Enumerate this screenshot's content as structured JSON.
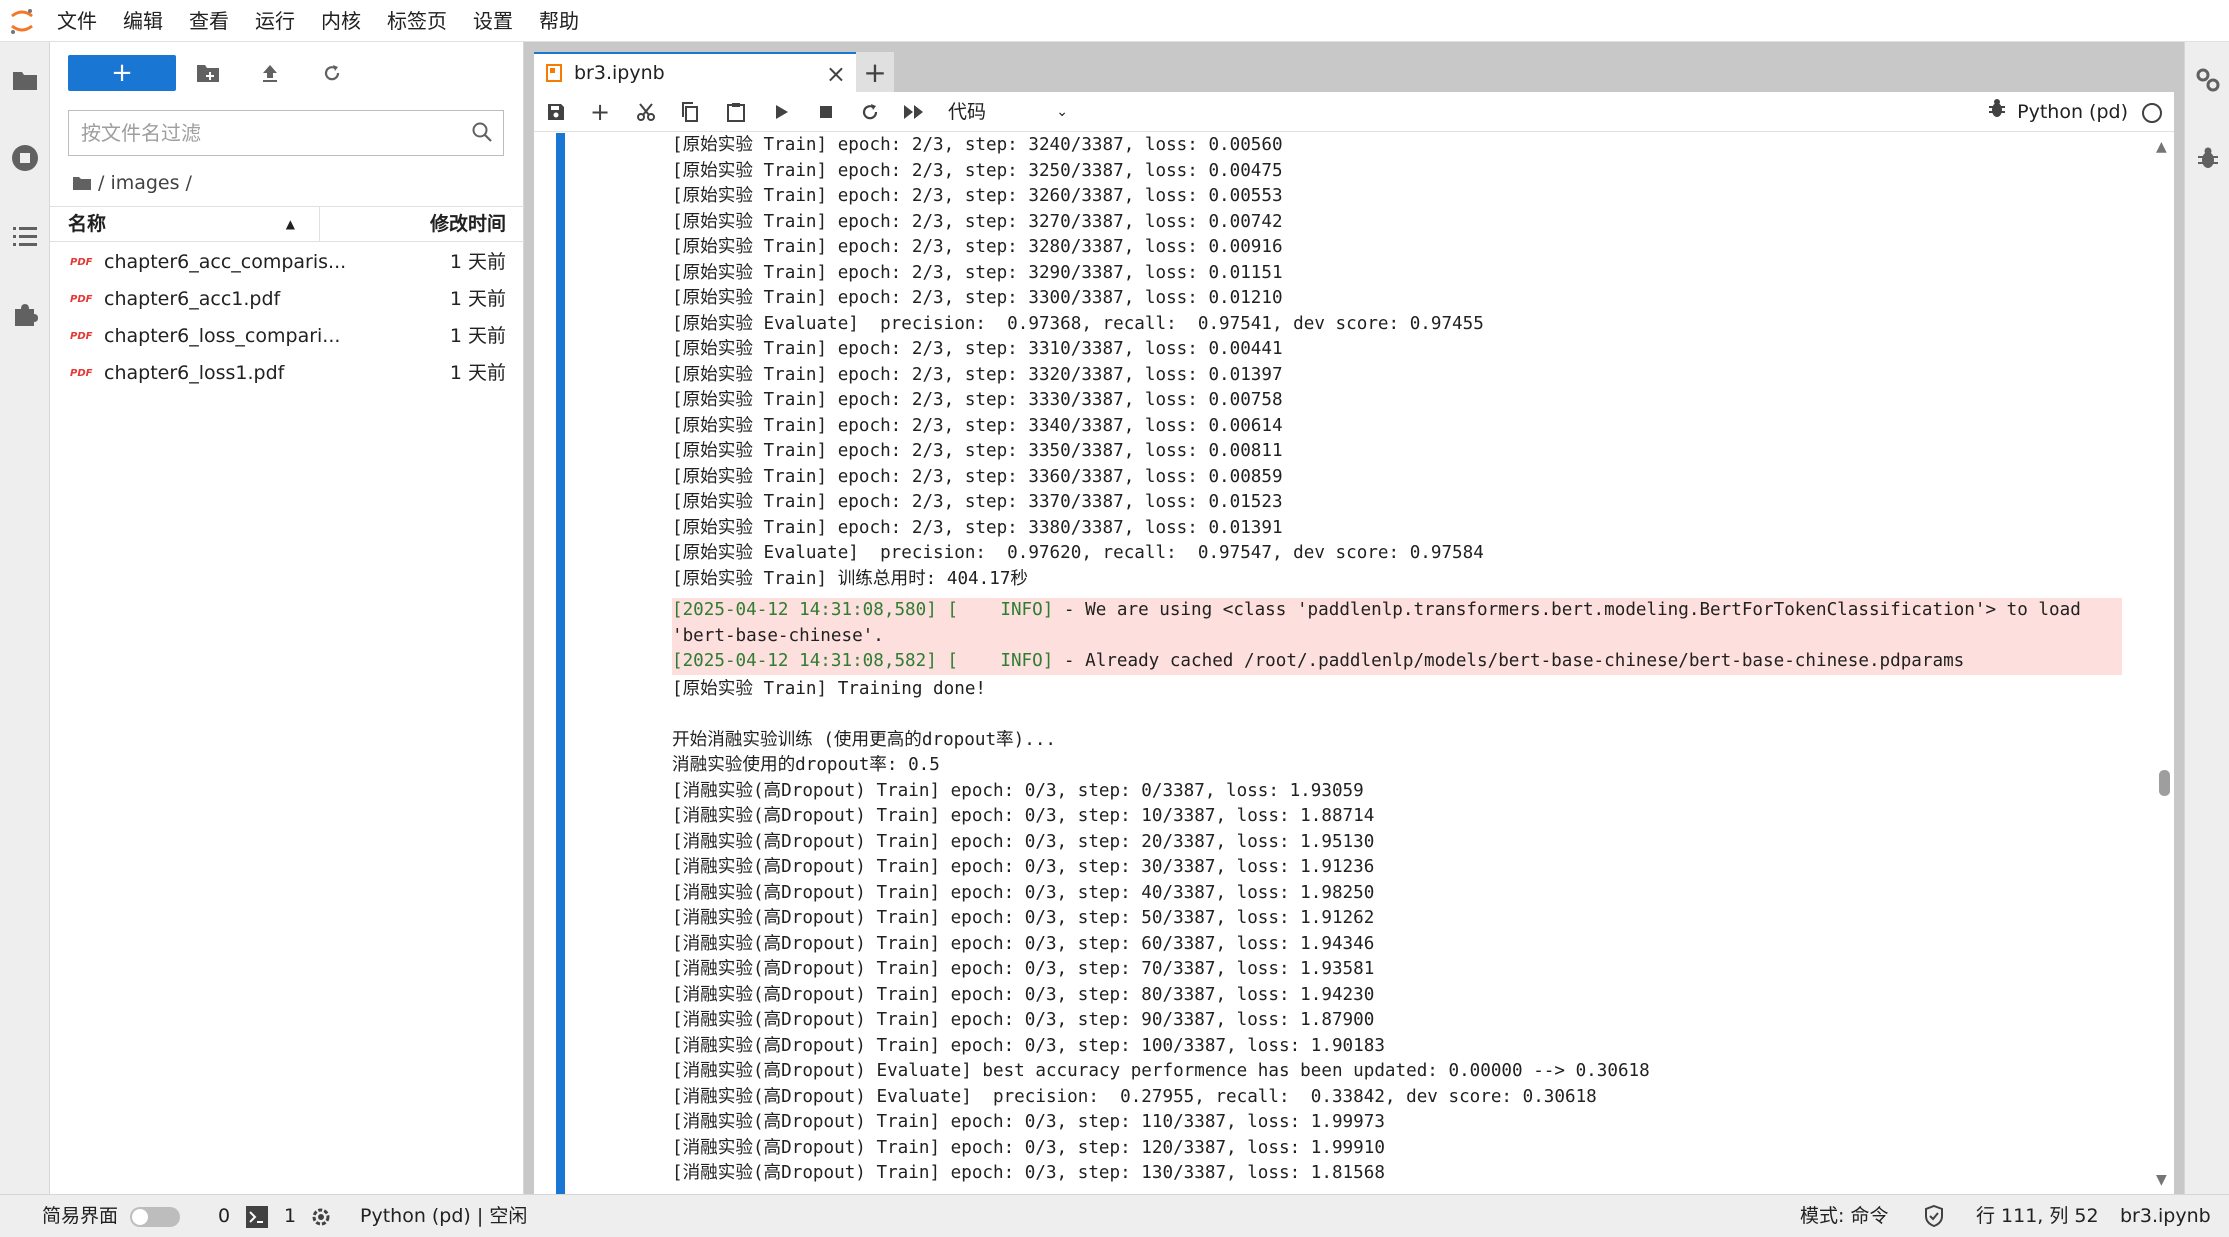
{
  "menu": [
    "文件",
    "编辑",
    "查看",
    "运行",
    "内核",
    "标签页",
    "设置",
    "帮助"
  ],
  "filebrowser": {
    "new_label": "+",
    "filter_placeholder": "按文件名过滤",
    "breadcrumb": "/ images /",
    "col_name": "名称",
    "col_modified": "修改时间",
    "files": [
      {
        "name": "chapter6_acc_comparis...",
        "modified": "1 天前"
      },
      {
        "name": "chapter6_acc1.pdf",
        "modified": "1 天前"
      },
      {
        "name": "chapter6_loss_compari...",
        "modified": "1 天前"
      },
      {
        "name": "chapter6_loss1.pdf",
        "modified": "1 天前"
      }
    ]
  },
  "tab": {
    "label": "br3.ipynb",
    "close": "×",
    "add": "+"
  },
  "toolbar": {
    "cell_type": "代码",
    "kernel": "Python (pd)"
  },
  "output": {
    "lines_a": [
      "[原始实验 Train] epoch: 2/3, step: 3240/3387, loss: 0.00560",
      "[原始实验 Train] epoch: 2/3, step: 3250/3387, loss: 0.00475",
      "[原始实验 Train] epoch: 2/3, step: 3260/3387, loss: 0.00553",
      "[原始实验 Train] epoch: 2/3, step: 3270/3387, loss: 0.00742",
      "[原始实验 Train] epoch: 2/3, step: 3280/3387, loss: 0.00916",
      "[原始实验 Train] epoch: 2/3, step: 3290/3387, loss: 0.01151",
      "[原始实验 Train] epoch: 2/3, step: 3300/3387, loss: 0.01210",
      "[原始实验 Evaluate]  precision:  0.97368, recall:  0.97541, dev score: 0.97455",
      "[原始实验 Train] epoch: 2/3, step: 3310/3387, loss: 0.00441",
      "[原始实验 Train] epoch: 2/3, step: 3320/3387, loss: 0.01397",
      "[原始实验 Train] epoch: 2/3, step: 3330/3387, loss: 0.00758",
      "[原始实验 Train] epoch: 2/3, step: 3340/3387, loss: 0.00614",
      "[原始实验 Train] epoch: 2/3, step: 3350/3387, loss: 0.00811",
      "[原始实验 Train] epoch: 2/3, step: 3360/3387, loss: 0.00859",
      "[原始实验 Train] epoch: 2/3, step: 3370/3387, loss: 0.01523",
      "[原始实验 Train] epoch: 2/3, step: 3380/3387, loss: 0.01391",
      "[原始实验 Evaluate]  precision:  0.97620, recall:  0.97547, dev score: 0.97584",
      "[原始实验 Train] 训练总用时: 404.17秒"
    ],
    "stderr": [
      {
        "ts": "[2025-04-12 14:31:08,580] [    INFO]",
        "msg": " - We are using <class 'paddlenlp.transformers.bert.modeling.BertForTokenClassification'> to load"
      },
      {
        "ts": "",
        "msg": "'bert-base-chinese'."
      },
      {
        "ts": "[2025-04-12 14:31:08,582] [    INFO]",
        "msg": " - Already cached /root/.paddlenlp/models/bert-base-chinese/bert-base-chinese.pdparams"
      }
    ],
    "lines_b": [
      "[原始实验 Train] Training done!"
    ],
    "lines_c": [
      "开始消融实验训练 (使用更高的dropout率)...",
      "消融实验使用的dropout率: 0.5",
      "[消融实验(高Dropout) Train] epoch: 0/3, step: 0/3387, loss: 1.93059",
      "[消融实验(高Dropout) Train] epoch: 0/3, step: 10/3387, loss: 1.88714",
      "[消融实验(高Dropout) Train] epoch: 0/3, step: 20/3387, loss: 1.95130",
      "[消融实验(高Dropout) Train] epoch: 0/3, step: 30/3387, loss: 1.91236",
      "[消融实验(高Dropout) Train] epoch: 0/3, step: 40/3387, loss: 1.98250",
      "[消融实验(高Dropout) Train] epoch: 0/3, step: 50/3387, loss: 1.91262",
      "[消融实验(高Dropout) Train] epoch: 0/3, step: 60/3387, loss: 1.94346",
      "[消融实验(高Dropout) Train] epoch: 0/3, step: 70/3387, loss: 1.93581",
      "[消融实验(高Dropout) Train] epoch: 0/3, step: 80/3387, loss: 1.94230",
      "[消融实验(高Dropout) Train] epoch: 0/3, step: 90/3387, loss: 1.87900",
      "[消融实验(高Dropout) Train] epoch: 0/3, step: 100/3387, loss: 1.90183",
      "[消融实验(高Dropout) Evaluate] best accuracy performence has been updated: 0.00000 --> 0.30618",
      "[消融实验(高Dropout) Evaluate]  precision:  0.27955, recall:  0.33842, dev score: 0.30618",
      "[消融实验(高Dropout) Train] epoch: 0/3, step: 110/3387, loss: 1.99973",
      "[消融实验(高Dropout) Train] epoch: 0/3, step: 120/3387, loss: 1.99910",
      "[消融实验(高Dropout) Train] epoch: 0/3, step: 130/3387, loss: 1.81568"
    ]
  },
  "status": {
    "simple_mode": "简易界面",
    "count0": "0",
    "count1": "1",
    "kernel": "Python (pd) | 空闲",
    "mode": "模式: 命令",
    "position": "行 111, 列 52",
    "filename": "br3.ipynb"
  },
  "colors": {
    "accent": "#1976d2",
    "stderr_bg": "#fddfdd",
    "timestamp": "#2e7d32"
  }
}
